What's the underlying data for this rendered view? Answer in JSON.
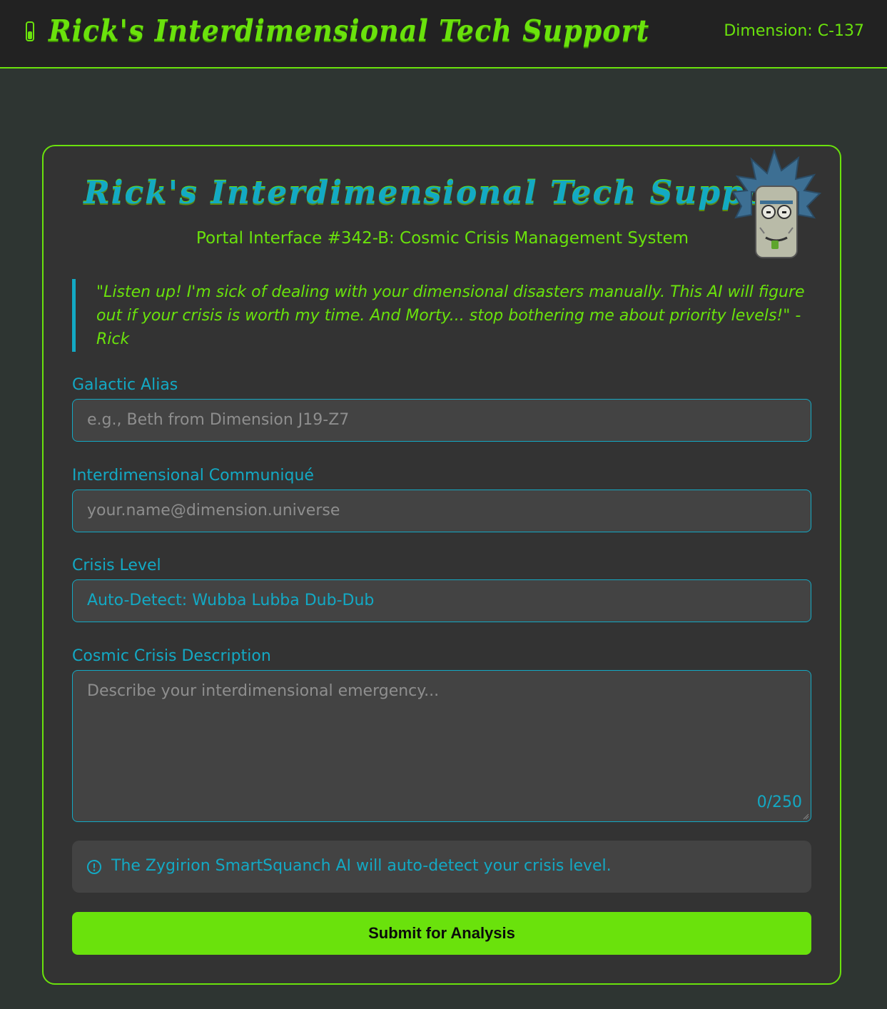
{
  "topbar": {
    "brand": "Rick's Interdimensional Tech Support",
    "dimension": "Dimension: C-137",
    "brand_icon": "test-tube-icon"
  },
  "header": {
    "title": "Rick's Interdimensional Tech Support",
    "subtitle": "Portal Interface #342-B: Cosmic Crisis Management System",
    "avatar": "rick-pixel-avatar"
  },
  "quote": "\"Listen up! I'm sick of dealing with your dimensional disasters manually. This AI will figure out if your crisis is worth my time. And Morty... stop bothering me about priority levels!\" - Rick",
  "form": {
    "alias": {
      "label": "Galactic Alias",
      "placeholder": "e.g., Beth from Dimension J19-Z7"
    },
    "email": {
      "label": "Interdimensional Communiqué",
      "placeholder": "your.name@dimension.universe"
    },
    "crisis_level": {
      "label": "Crisis Level",
      "value": "Auto-Detect: Wubba Lubba Dub-Dub"
    },
    "description": {
      "label": "Cosmic Crisis Description",
      "placeholder": "Describe your interdimensional emergency...",
      "counter": "0/250"
    }
  },
  "notice": {
    "text": "The Zygirion SmartSquanch AI will auto-detect your crisis level.",
    "icon": "info-circle-icon"
  },
  "submit_label": "Submit for Analysis",
  "colors": {
    "accent_green": "#6ae20c",
    "accent_cyan": "#13a9c4",
    "background": "#2e3532",
    "card": "#333333"
  }
}
